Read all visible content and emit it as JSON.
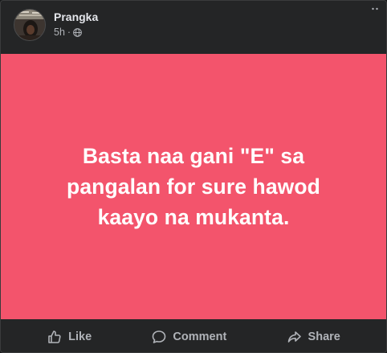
{
  "post": {
    "author": "Prangka",
    "time": "5h",
    "separator": "·",
    "privacy_icon": "globe-icon",
    "background_color": "#f3546c",
    "text": "Basta naa gani \"E\" sa pangalan for sure hawod kaayo na mukanta."
  },
  "actions": {
    "like_label": "Like",
    "comment_label": "Comment",
    "share_label": "Share"
  }
}
